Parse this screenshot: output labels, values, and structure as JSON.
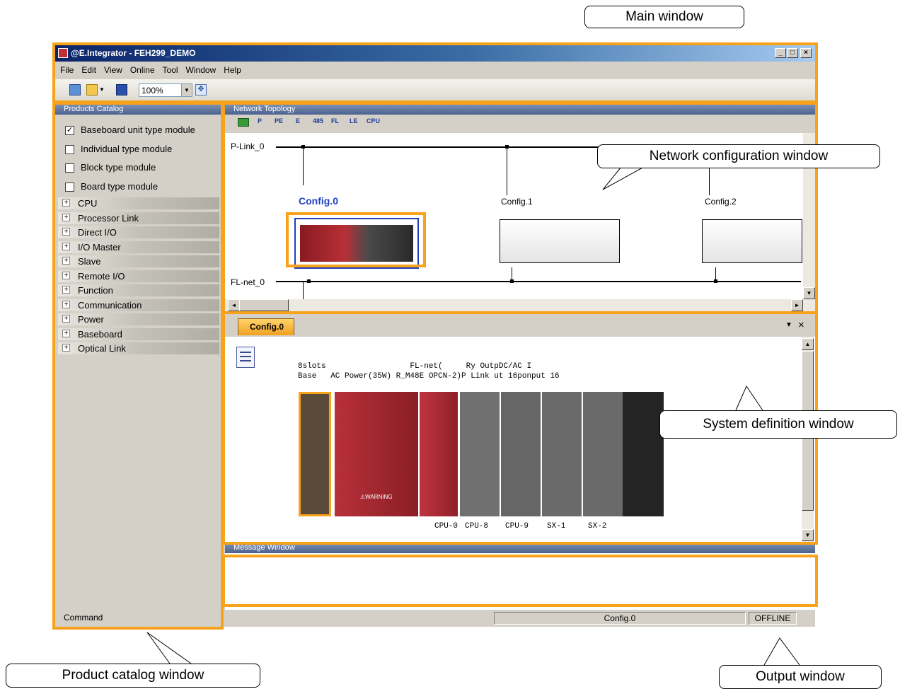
{
  "app": {
    "title": "@E.Integrator - FEH299_DEMO",
    "window_controls": [
      "_",
      "□",
      "×"
    ],
    "menu": [
      "File",
      "Edit",
      "View",
      "Online",
      "Tool",
      "Window",
      "Help"
    ],
    "toolbar": {
      "zoom": "100%"
    }
  },
  "catalog": {
    "title": "Products Catalog",
    "options": [
      {
        "label": "Baseboard unit type module",
        "checked": true
      },
      {
        "label": "Individual type module",
        "checked": false
      },
      {
        "label": "Block type module",
        "checked": false
      },
      {
        "label": "Board type module",
        "checked": false
      }
    ],
    "categories": [
      "CPU",
      "Processor Link",
      "Direct I/O",
      "I/O Master",
      "Slave",
      "Remote I/O",
      "Function",
      "Communication",
      "Power",
      "Baseboard",
      "Optical Link"
    ],
    "command_label": "Command"
  },
  "network": {
    "title": "Network Topology",
    "toolbar_icons": [
      "P",
      "PE",
      "E",
      "485",
      "FL",
      "LE",
      "CPU"
    ],
    "buses": [
      "P-Link_0",
      "FL-net_0"
    ],
    "configs": [
      "Config.0",
      "Config.1",
      "Config.2"
    ]
  },
  "sysdef": {
    "tab": "Config.0",
    "module_labels_line1": "8slots                  FL-net(     Ry OutpDC/AC I",
    "module_labels_line2": "Base   AC Power(35W) R_M48E OPCN-2)P Link ut 16ponput 16",
    "slot_labels": [
      "CPU-0",
      "CPU-8",
      "CPU-9",
      "SX-1",
      "SX-2"
    ],
    "warning_text": "⚠WARNING"
  },
  "message": {
    "title": "Message Window",
    "status_config": "Config.0",
    "status_mode": "OFFLINE"
  },
  "callouts": {
    "main": "Main window",
    "network": "Network configuration window",
    "system": "System definition window",
    "catalog": "Product catalog window",
    "output": "Output window"
  },
  "colors": {
    "highlight": "#f7a21b",
    "selected_config": "#2040c0",
    "module_red": "#a8232a",
    "module_gray": "#6a6a6a"
  }
}
